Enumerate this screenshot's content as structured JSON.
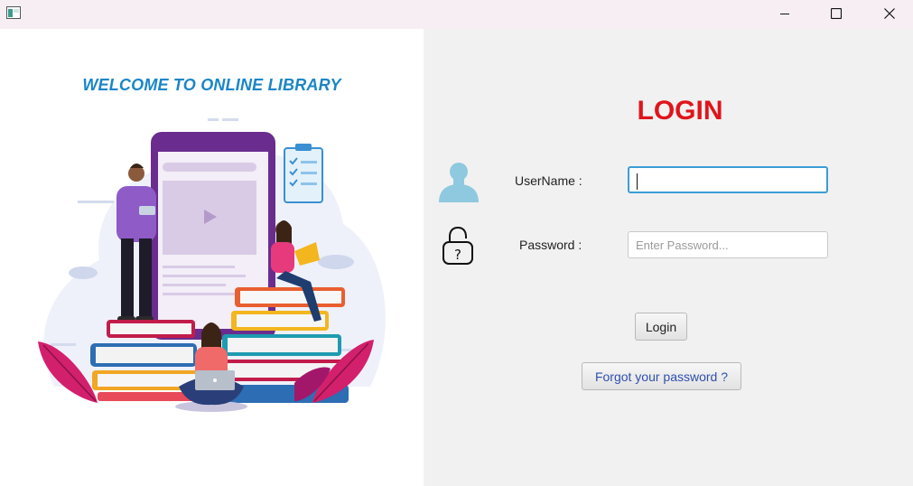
{
  "window": {
    "icons": {
      "app": "window-icon",
      "minimize": "minimize-icon",
      "maximize": "maximize-icon",
      "close": "close-icon"
    }
  },
  "left": {
    "welcome_text": "WELCOME TO ONLINE LIBRARY",
    "illustration": "library-reading-illustration"
  },
  "login": {
    "title": "LOGIN",
    "username_label": "UserName :",
    "username_value": "",
    "password_label": "Password :",
    "password_value": "",
    "password_placeholder": "Enter Password...",
    "login_button": "Login",
    "forgot_button": "Forgot your password ?"
  },
  "colors": {
    "title_red": "#e0141b",
    "welcome_blue": "#1a86c7",
    "focus_blue": "#3b9ed6",
    "link_blue": "#2f4fae"
  }
}
